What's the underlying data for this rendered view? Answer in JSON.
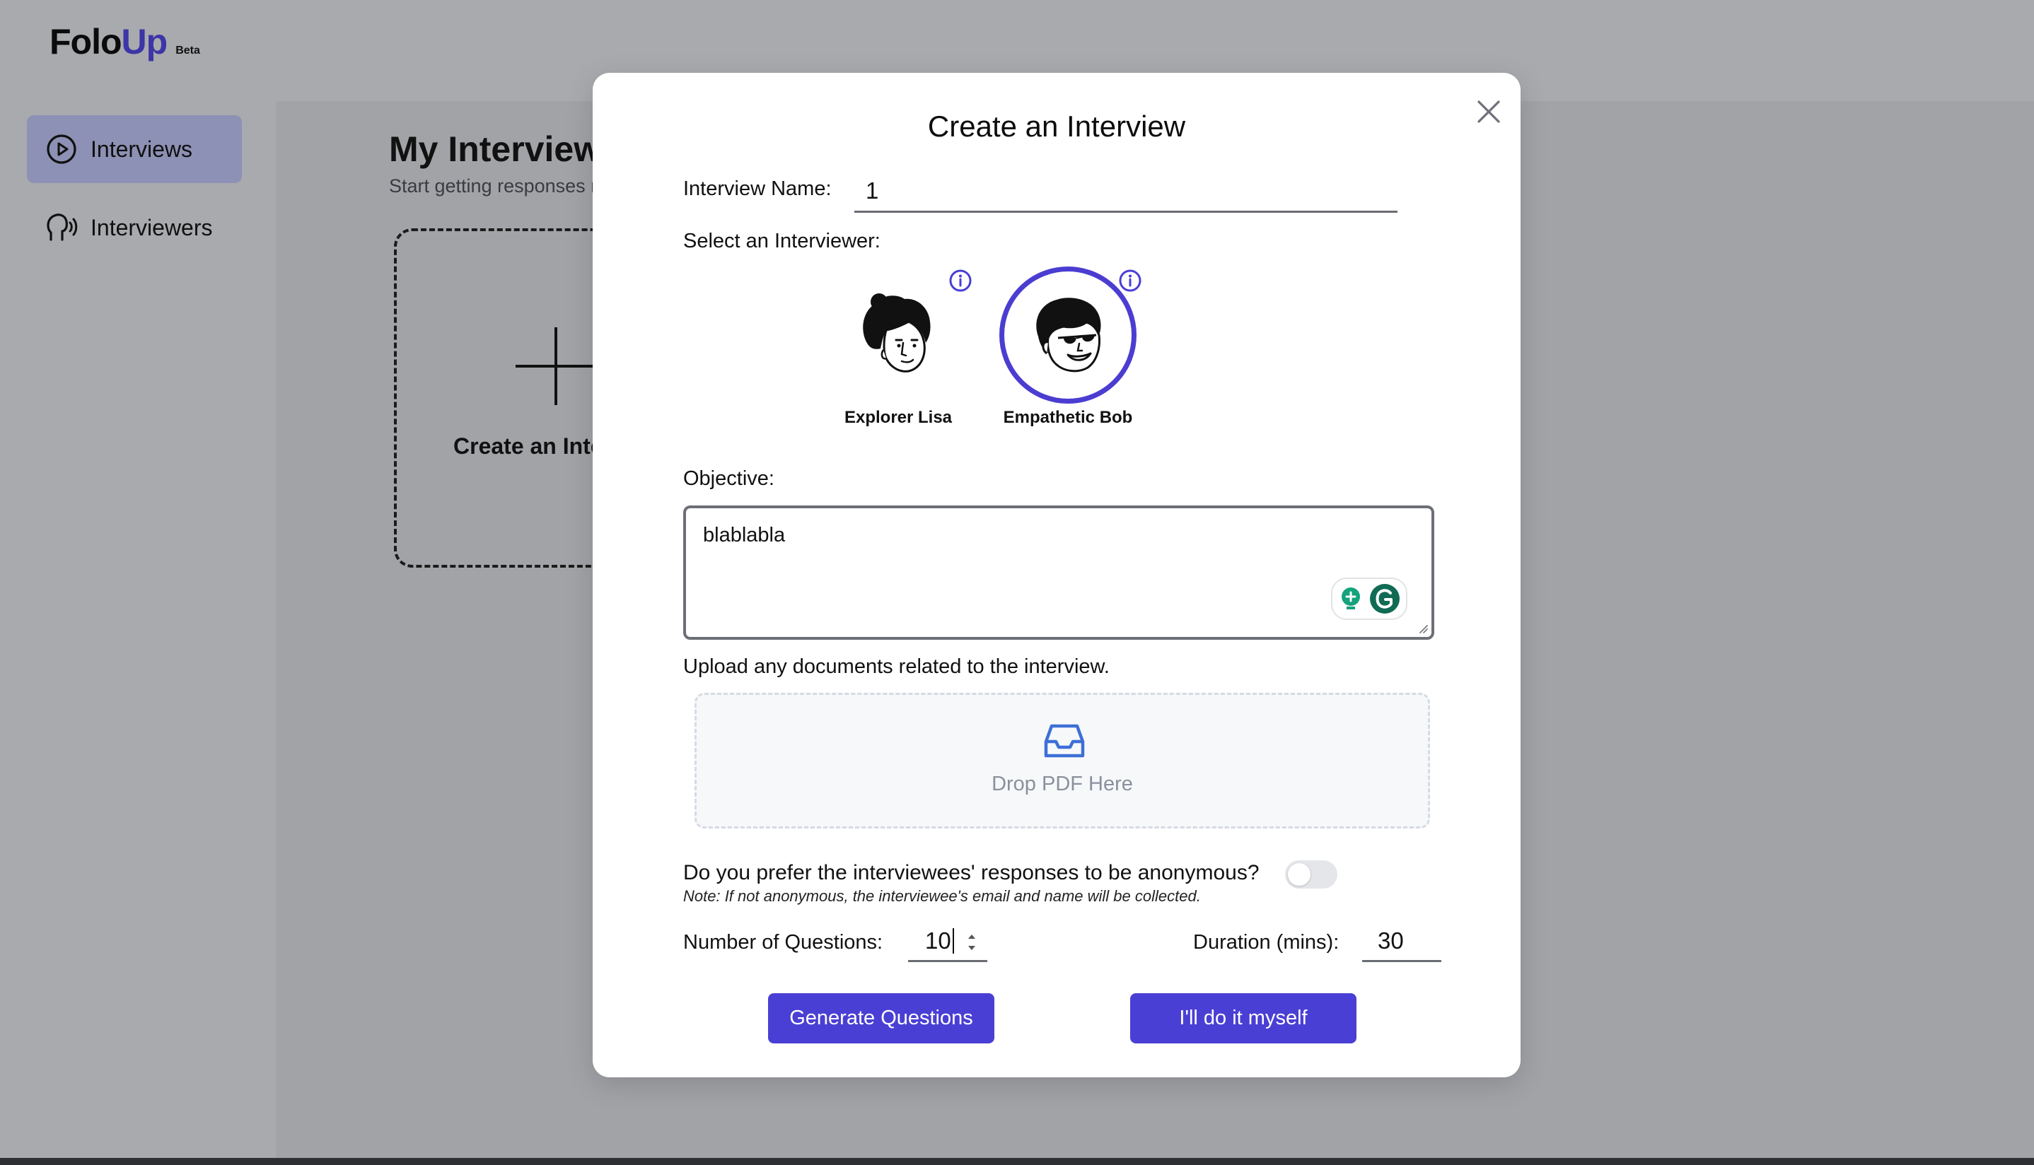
{
  "app": {
    "logo_part1": "Folo",
    "logo_part2": "Up",
    "badge": "Beta",
    "accent_color": "#4a3fd4"
  },
  "sidebar": {
    "items": [
      {
        "label": "Interviews",
        "icon": "play-circle-icon",
        "active": true
      },
      {
        "label": "Interviewers",
        "icon": "speaking-head-icon",
        "active": false
      }
    ]
  },
  "main": {
    "title": "My Interviews",
    "subtitle": "Start getting responses now!",
    "create_card_label": "Create an Interview"
  },
  "modal": {
    "title": "Create an Interview",
    "interview_name_label": "Interview Name:",
    "interview_name_value": "1",
    "select_interviewer_label": "Select an Interviewer:",
    "interviewers": [
      {
        "name": "Explorer Lisa",
        "selected": false
      },
      {
        "name": "Empathetic Bob",
        "selected": true
      }
    ],
    "objective_label": "Objective:",
    "objective_value": "blablabla",
    "upload_label": "Upload any documents related to the interview.",
    "dropzone_text": "Drop PDF Here",
    "anonymous_question": "Do you prefer the interviewees' responses to be anonymous?",
    "anonymous_enabled": false,
    "anonymous_note": "Note: If not anonymous, the interviewee's email and name will be collected.",
    "num_questions_label": "Number of Questions:",
    "num_questions_value": "10",
    "duration_label": "Duration (mins):",
    "duration_value": "30",
    "generate_button": "Generate Questions",
    "manual_button": "I'll do it myself"
  }
}
